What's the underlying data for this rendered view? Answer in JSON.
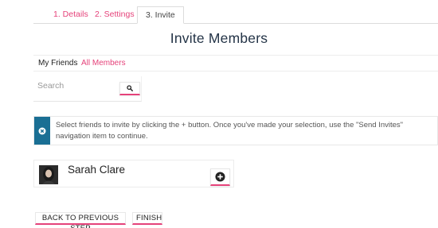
{
  "tabs": [
    {
      "label": "1. Details"
    },
    {
      "label": "2. Settings"
    },
    {
      "label": "3. Invite",
      "active": true
    }
  ],
  "page_title": "Invite Members",
  "subnav": {
    "my_friends": "My Friends",
    "all_members": "All Members"
  },
  "search": {
    "placeholder": "Search",
    "button_icon": "search-icon"
  },
  "banner": {
    "icon": "close-circle-icon",
    "text": "Select friends to invite by clicking the + button. Once you've made your selection, use the \"Send Invites\" navigation item to continue."
  },
  "friends": [
    {
      "name": "Sarah Clare",
      "add_icon": "plus-circle-icon"
    }
  ],
  "footer": {
    "back_label": "BACK TO PREVIOUS STEP",
    "finish_label": "FINISH"
  },
  "colors": {
    "accent": "#e5427a",
    "info": "#1a6f94",
    "title": "#243447"
  }
}
